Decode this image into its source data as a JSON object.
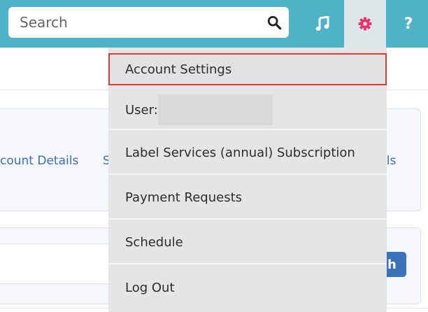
{
  "header": {
    "search_placeholder": "Search",
    "icons": [
      "search-icon",
      "music-note-icon",
      "gear-icon",
      "help-icon"
    ],
    "help_glyph": "?"
  },
  "background": {
    "account_details_link": "count Details",
    "s_link": "S",
    "ils_link": "ils",
    "search_button_fragment": "h"
  },
  "dropdown": {
    "items": [
      {
        "label": "Account Settings",
        "selected": true
      },
      {
        "label": "User:",
        "redacted": true
      },
      {
        "label": "Label Services (annual) Subscription"
      },
      {
        "label": "Payment Requests"
      },
      {
        "label": "Schedule"
      },
      {
        "label": "Log Out"
      }
    ]
  },
  "colors": {
    "topbar": "#4fb3c8",
    "gear_active_bg": "#dde6e9",
    "gear_icon": "#e8336d",
    "link_blue": "#3d6fb0",
    "selection_outline": "#e53935"
  }
}
